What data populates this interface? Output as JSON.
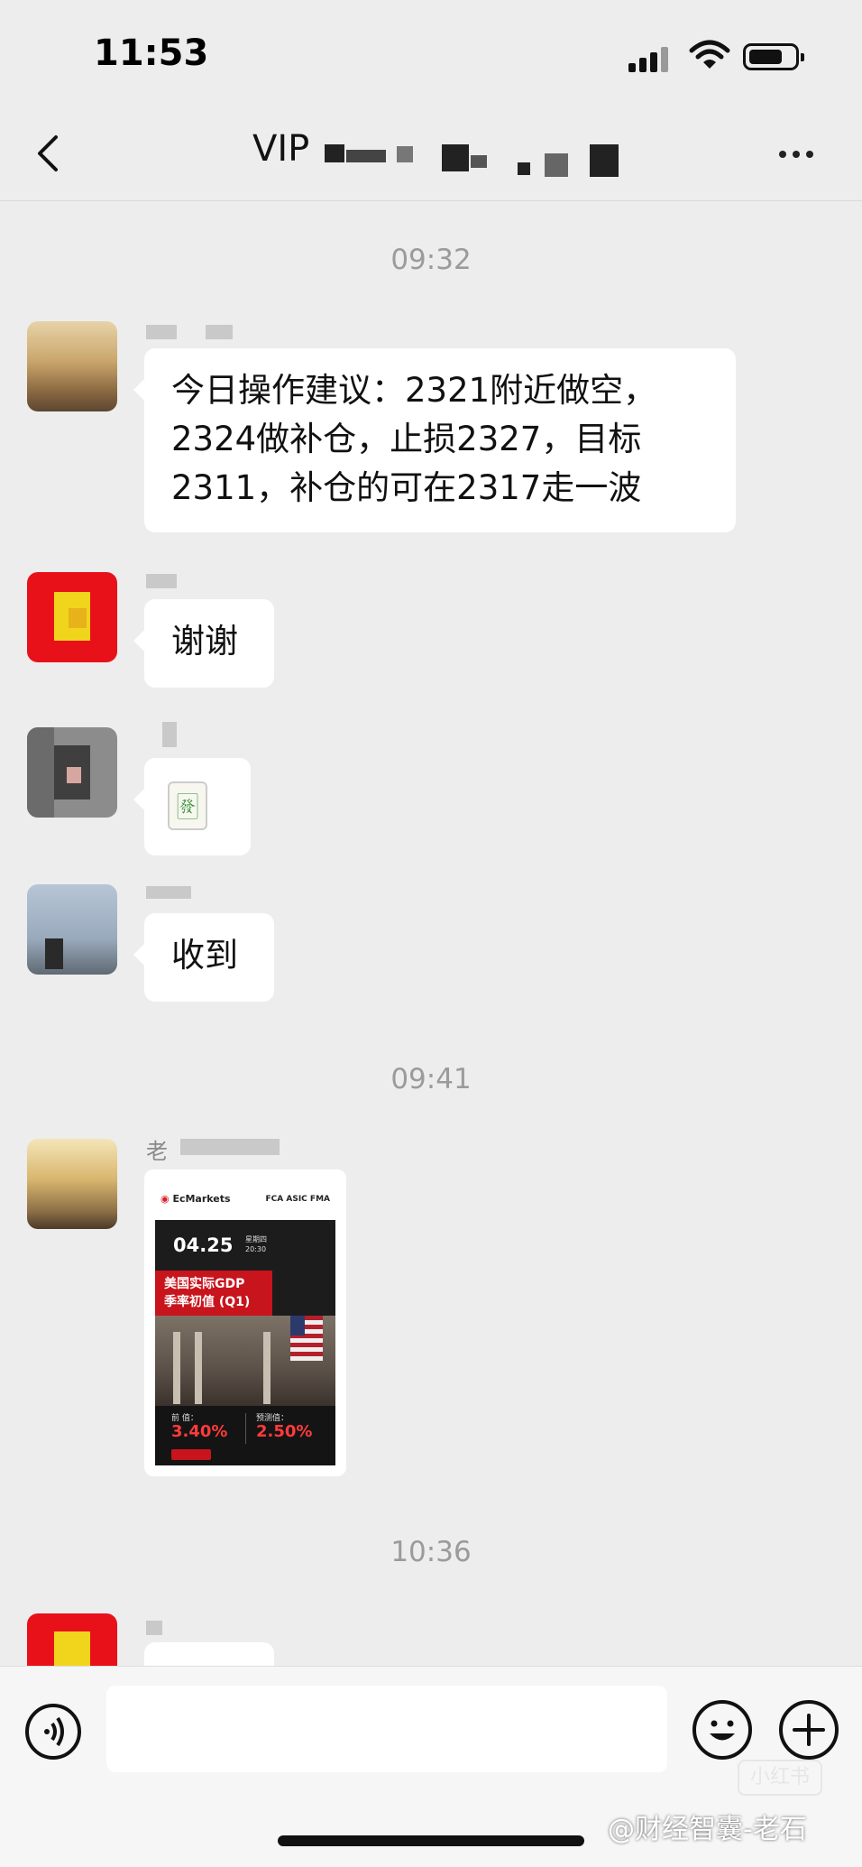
{
  "status_bar": {
    "time": "11:53"
  },
  "header": {
    "title": "VIP",
    "more_icon": "more-icon",
    "back_icon": "chevron-left-icon"
  },
  "chat": {
    "timestamps": [
      "09:32",
      "09:41",
      "10:36"
    ],
    "messages": [
      {
        "type": "text",
        "lines": [
          "今日操作建议：2321附近做空，",
          "2324做补仓，止损2327，目标",
          "2311，补仓的可在2317走一波"
        ]
      },
      {
        "type": "text",
        "text": "谢谢"
      },
      {
        "type": "emoji",
        "text": "🀅"
      },
      {
        "type": "text",
        "text": "收到"
      },
      {
        "type": "image",
        "sender": "老",
        "card": {
          "brand": "EcMarkets",
          "regulators": "FCA  ASIC  FMA",
          "date": "04.25",
          "weekday": "星期四",
          "time": "20:30",
          "title_line1": "美国实际GDP",
          "title_line2": "季率初值 (Q1)",
          "prev_label": "前  值：",
          "prev_value": "3.40%",
          "forecast_label": "预测值：",
          "forecast_value": "2.50%"
        }
      }
    ]
  },
  "input_bar": {
    "placeholder": "",
    "voice_icon": "voice-icon",
    "emoji_icon": "emoji-icon",
    "plus_icon": "plus-icon"
  },
  "watermark": {
    "text": "@财经智囊-老石",
    "logo": "小红书"
  },
  "colors": {
    "background": "#ededed",
    "bubble": "#ffffff",
    "timestamp": "#9b9b9b",
    "accent_red": "#c8141c"
  }
}
